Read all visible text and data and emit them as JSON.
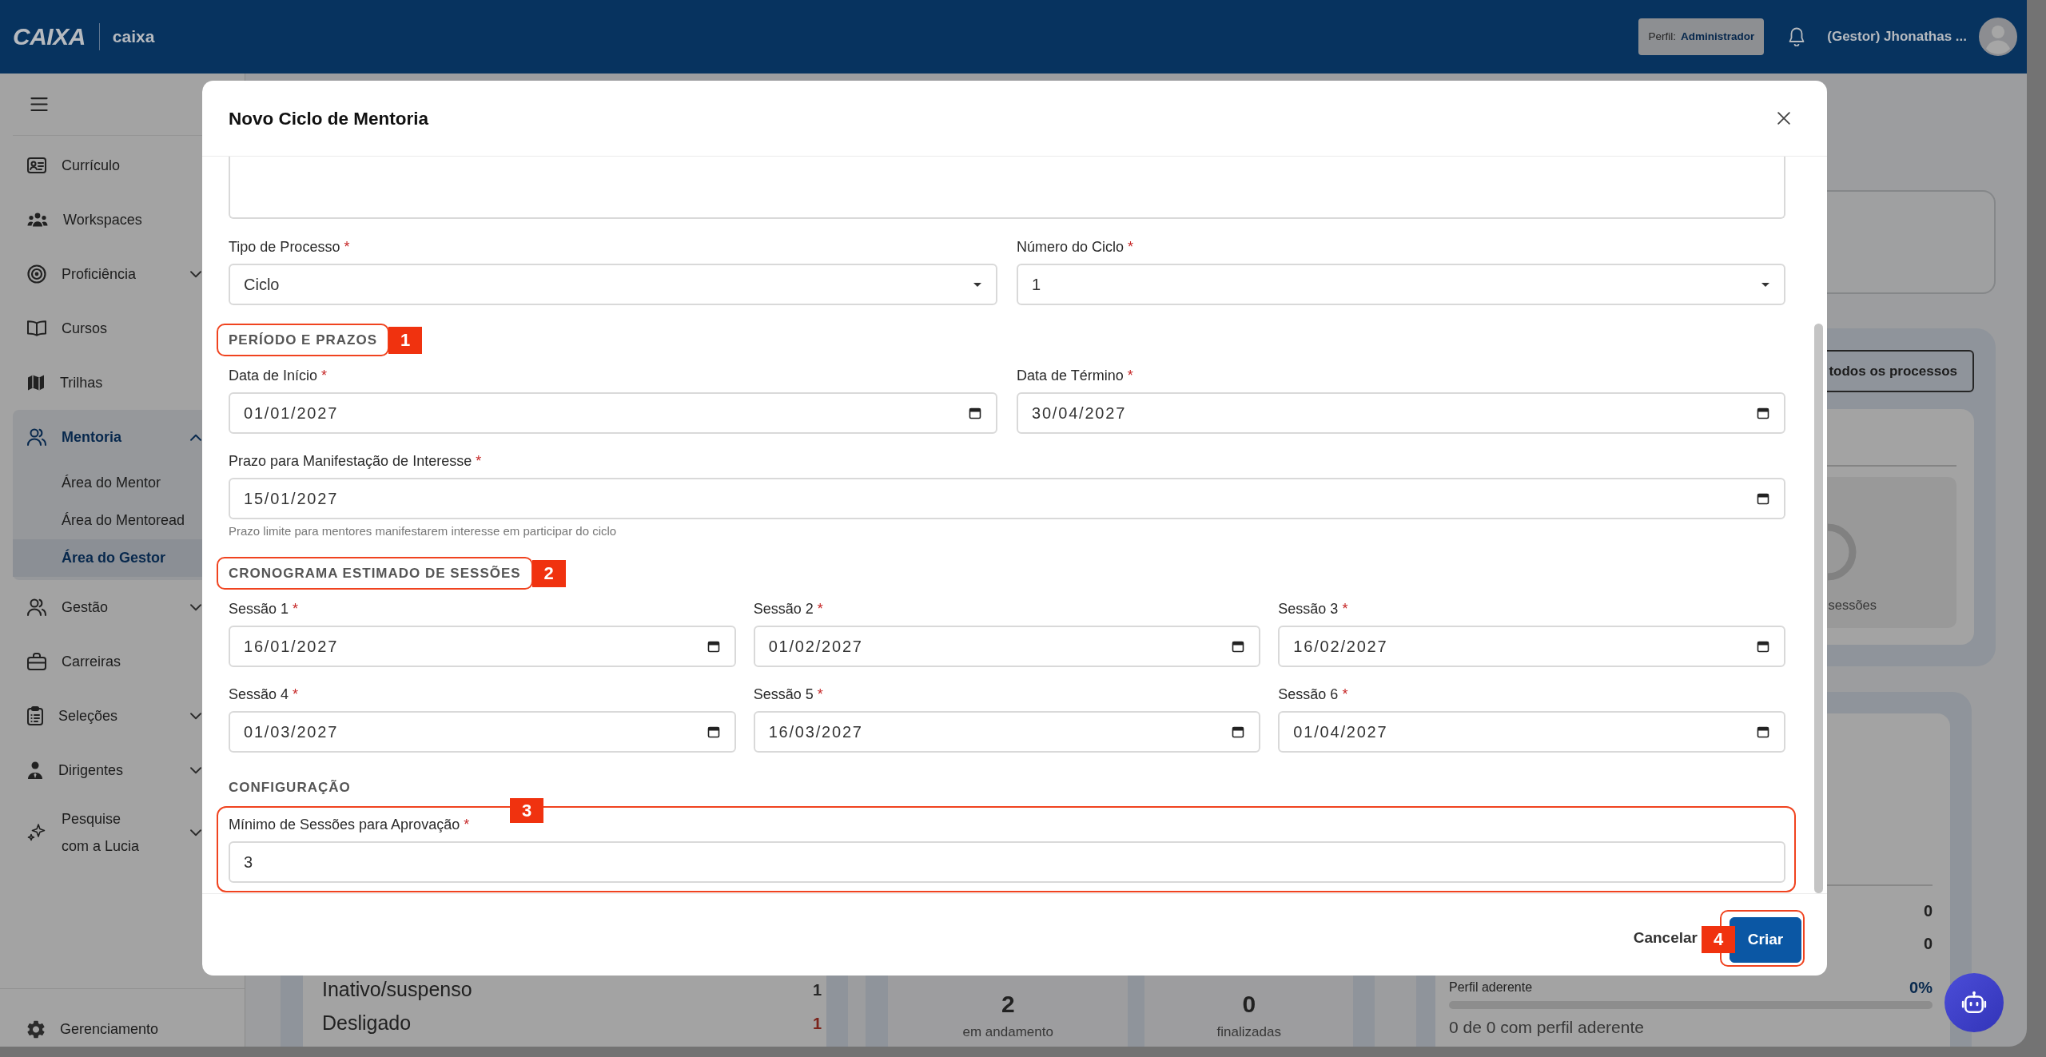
{
  "header": {
    "logo": "CAIXA",
    "brand": "caixa",
    "profile": {
      "label": "Perfil:",
      "value": "Administrador"
    },
    "user_name": "(Gestor) Jhonathas ..."
  },
  "sidebar": {
    "items": [
      {
        "label": "Currículo",
        "selected": false
      },
      {
        "label": "Workspaces",
        "selected": false
      },
      {
        "label": "Proficiência",
        "selected": false,
        "expanded": false
      },
      {
        "label": "Cursos",
        "selected": false
      },
      {
        "label": "Trilhas",
        "selected": false
      },
      {
        "label": "Mentoria",
        "selected": true,
        "expanded": true,
        "children": [
          {
            "label": "Área do Mentor",
            "selected": false
          },
          {
            "label": "Área do Mentoread",
            "selected": false
          },
          {
            "label": "Área do Gestor",
            "selected": true
          }
        ]
      },
      {
        "label": "Gestão",
        "selected": false,
        "expanded": false
      },
      {
        "label": "Carreiras",
        "selected": false
      },
      {
        "label": "Seleções",
        "selected": false,
        "expanded": false
      },
      {
        "label": "Dirigentes",
        "selected": false,
        "expanded": false
      },
      {
        "label": "Pesquise com a Lucia",
        "selected": false,
        "expanded": false
      }
    ],
    "footer_item": {
      "label": "Gerenciamento"
    }
  },
  "dashboard": {
    "process_panel": {
      "button": "todos os processos",
      "chart_caption": "sessões"
    },
    "status_rows": [
      {
        "label": "Inativo/suspenso",
        "value": "1",
        "color": "#272727"
      },
      {
        "label": "Desligado",
        "value": "1",
        "color": "#7b241c"
      }
    ],
    "session_stats": [
      {
        "value": "2",
        "caption": "em andamento"
      },
      {
        "value": "0",
        "caption": "finalizadas"
      }
    ],
    "profile_summary": {
      "values": [
        "0",
        "0"
      ],
      "label": "Perfil aderente",
      "reading": "0%",
      "caption": "0 de 0 com perfil aderente"
    }
  },
  "modal": {
    "title": "Novo Ciclo de Mentoria",
    "blocks": [
      {
        "kind": "textarea"
      },
      {
        "kind": "fields",
        "fields": [
          {
            "kind": "select",
            "label": "Tipo de Processo",
            "required_mark": "*",
            "value": "Ciclo"
          },
          {
            "kind": "select",
            "label": "Número do Ciclo",
            "required_mark": "*",
            "value": "1"
          }
        ]
      },
      {
        "kind": "heading",
        "text": "PERÍODO E PRAZOS",
        "callout": "1"
      },
      {
        "kind": "fields",
        "fields": [
          {
            "kind": "date",
            "label": "Data de Início",
            "required_mark": "*",
            "value": "01/01/2027"
          },
          {
            "kind": "date",
            "label": "Data de Término",
            "required_mark": "*",
            "value": "30/04/2027"
          }
        ]
      },
      {
        "kind": "fields",
        "fields": [
          {
            "kind": "date",
            "label": "Prazo para Manifestação de Interesse",
            "required_mark": "*",
            "value": "15/01/2027",
            "help": "Prazo limite para mentores manifestarem interesse em participar do ciclo"
          }
        ]
      },
      {
        "kind": "heading",
        "text": "CRONOGRAMA ESTIMADO DE SESSÕES",
        "callout": "2"
      },
      {
        "kind": "fields",
        "fields": [
          {
            "kind": "date",
            "label": "Sessão 1",
            "required_mark": "*",
            "value": "16/01/2027"
          },
          {
            "kind": "date",
            "label": "Sessão 2",
            "required_mark": "*",
            "value": "01/02/2027"
          },
          {
            "kind": "date",
            "label": "Sessão 3",
            "required_mark": "*",
            "value": "16/02/2027"
          }
        ]
      },
      {
        "kind": "fields",
        "fields": [
          {
            "kind": "date",
            "label": "Sessão 4",
            "required_mark": "*",
            "value": "01/03/2027"
          },
          {
            "kind": "date",
            "label": "Sessão 5",
            "required_mark": "*",
            "value": "16/03/2027"
          },
          {
            "kind": "date",
            "label": "Sessão 6",
            "required_mark": "*",
            "value": "01/04/2027"
          }
        ]
      },
      {
        "kind": "heading",
        "text": "CONFIGURAÇÃO"
      },
      {
        "kind": "fields",
        "callout": "3",
        "fields": [
          {
            "kind": "text",
            "label": "Mínimo de Sessões para Aprovação",
            "required_mark": "*",
            "value": "3"
          }
        ]
      }
    ],
    "buttons": [
      {
        "kind": "text",
        "label": "Cancelar"
      },
      {
        "kind": "primary",
        "label": "Criar",
        "callout": "4"
      }
    ]
  }
}
